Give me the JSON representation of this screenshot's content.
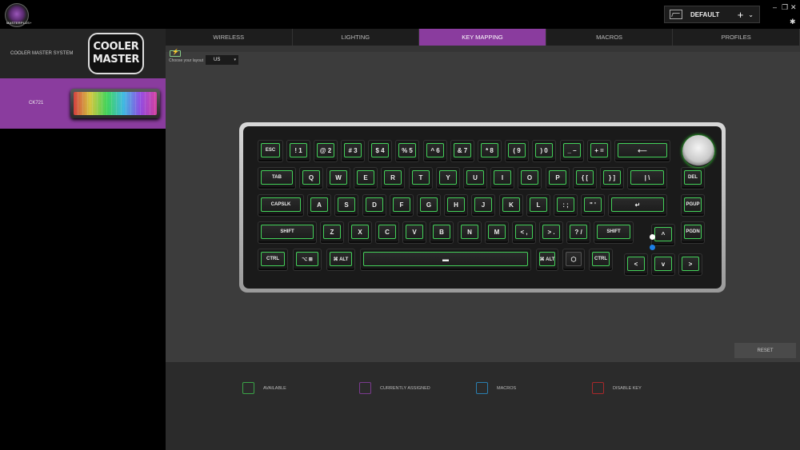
{
  "app": {
    "logo_text": "MASTERPLUS+"
  },
  "profile": {
    "name": "DEFAULT",
    "add_icon": "+",
    "dropdown_icon": "⌄"
  },
  "window": {
    "minimize": "–",
    "restore": "❐",
    "close": "✕",
    "settings": "✱"
  },
  "sidebar": {
    "system_label": "COOLER MASTER SYSTEM",
    "logo_line1": "COOLER",
    "logo_line2": "MASTER",
    "device_label": "CK721"
  },
  "tabs": [
    {
      "label": "WIRELESS"
    },
    {
      "label": "LIGHTING"
    },
    {
      "label": "KEY MAPPING"
    },
    {
      "label": "MACROS"
    },
    {
      "label": "PROFILES"
    }
  ],
  "layout": {
    "label": "Choose your layout",
    "value": "US",
    "dropdown_icon": "▾"
  },
  "keys": {
    "row1": [
      "ESC",
      "! 1",
      "@ 2",
      "# 3",
      "$ 4",
      "% 5",
      "^ 6",
      "& 7",
      "* 8",
      "( 9",
      ") 0",
      "_ –",
      "+ =",
      "⟵"
    ],
    "row2": [
      "TAB",
      "Q",
      "W",
      "E",
      "R",
      "T",
      "Y",
      "U",
      "I",
      "O",
      "P",
      "{ [",
      "} ]",
      "| \\"
    ],
    "row3": [
      "CAPSLK",
      "A",
      "S",
      "D",
      "F",
      "G",
      "H",
      "J",
      "K",
      "L",
      ": ;",
      "\" '",
      "↵"
    ],
    "row4": [
      "SHIFT",
      "Z",
      "X",
      "C",
      "V",
      "B",
      "N",
      "M",
      "< ,",
      "> .",
      "? /",
      "SHIFT"
    ],
    "row5": [
      "CTRL",
      "⌥ ⊞",
      "⌘ ALT",
      "▬",
      "⌘ ALT",
      "⬡",
      "CTRL"
    ],
    "right_col": [
      "DEL",
      "PGUP",
      "PGDN"
    ],
    "arrows": {
      "up": "^",
      "left": "<",
      "down": "v",
      "right": ">"
    }
  },
  "reset_label": "RESET",
  "legend": [
    {
      "label": "AVAILABLE",
      "color": "#3aa447"
    },
    {
      "label": "CURRENTLY ASSIGNED",
      "color": "#7b3a8f"
    },
    {
      "label": "MACROS",
      "color": "#2a7fb0"
    },
    {
      "label": "DISABLE KEY",
      "color": "#a8282b"
    }
  ]
}
